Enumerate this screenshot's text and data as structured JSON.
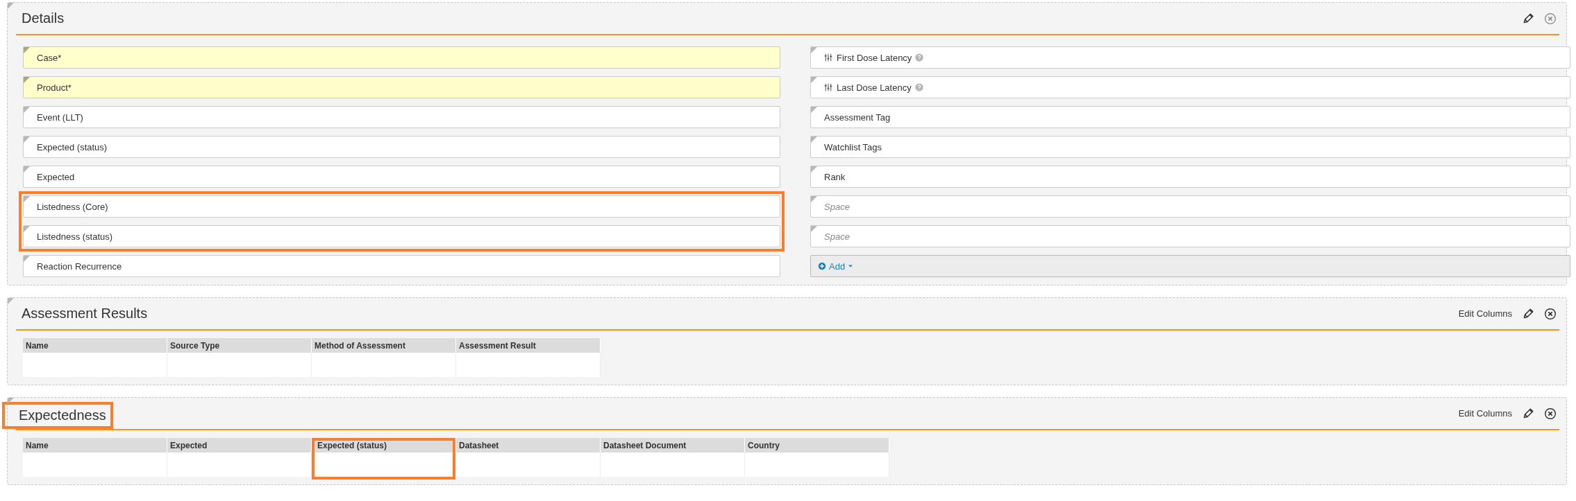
{
  "sections": [
    {
      "kind": "form",
      "title": "Details",
      "title_highlighted": false,
      "columns": [
        [
          {
            "kind": "required",
            "label": "Case*",
            "highlighted": false
          },
          {
            "kind": "required",
            "label": "Product*",
            "highlighted": false
          },
          {
            "kind": "normal",
            "label": "Event (LLT)",
            "highlighted": false
          },
          {
            "kind": "normal",
            "label": "Expected (status)",
            "highlighted": false
          },
          {
            "kind": "normal",
            "label": "Expected",
            "highlighted": false
          },
          {
            "kind": "normal",
            "label": "Listedness (Core)",
            "highlighted": true
          },
          {
            "kind": "normal",
            "label": "Listedness (status)",
            "highlighted": true
          },
          {
            "kind": "normal",
            "label": "Reaction Recurrence",
            "highlighted": false
          }
        ],
        [
          {
            "kind": "latency",
            "label": "First Dose Latency",
            "highlighted": false
          },
          {
            "kind": "latency",
            "label": "Last Dose Latency",
            "highlighted": false
          },
          {
            "kind": "normal",
            "label": "Assessment Tag",
            "highlighted": false
          },
          {
            "kind": "normal",
            "label": "Watchlist Tags",
            "highlighted": false
          },
          {
            "kind": "normal",
            "label": "Rank",
            "highlighted": false
          },
          {
            "kind": "placeholder",
            "label": "Space",
            "highlighted": false
          },
          {
            "kind": "placeholder",
            "label": "Space",
            "highlighted": false
          },
          {
            "kind": "add",
            "label": "Add",
            "highlighted": false
          }
        ]
      ]
    },
    {
      "kind": "table",
      "title": "Assessment Results",
      "title_highlighted": false,
      "edit_columns": "Edit Columns",
      "table": {
        "columns": [
          {
            "label": "Name",
            "highlighted": false
          },
          {
            "label": "Source Type",
            "highlighted": false
          },
          {
            "label": "Method of Assessment",
            "highlighted": false
          },
          {
            "label": "Assessment Result",
            "highlighted": false
          }
        ]
      }
    },
    {
      "kind": "table",
      "title": "Expectedness",
      "title_highlighted": true,
      "edit_columns": "Edit Columns",
      "table": {
        "columns": [
          {
            "label": "Name",
            "highlighted": false
          },
          {
            "label": "Expected",
            "highlighted": false
          },
          {
            "label": "Expected (status)",
            "highlighted": true
          },
          {
            "label": "Datasheet",
            "highlighted": false
          },
          {
            "label": "Datasheet Document",
            "highlighted": false
          },
          {
            "label": "Country",
            "highlighted": false
          }
        ]
      }
    }
  ]
}
